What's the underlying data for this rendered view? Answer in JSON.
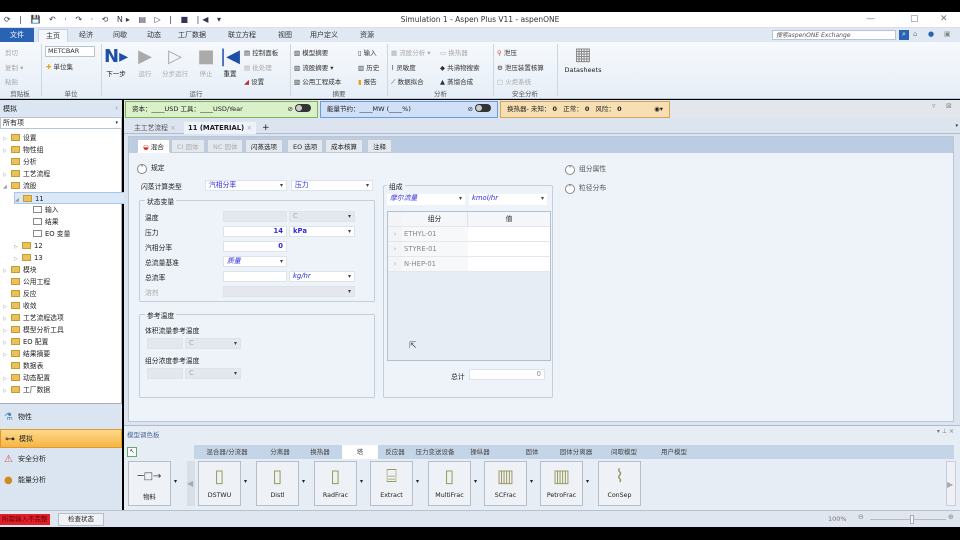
{
  "window": {
    "title": "Simulation 1 - Aspen Plus V11 - aspenONE",
    "quick_access": "⟳ | 💾 ↶ · ↷ · ⟲ N▸ ▤ ▷ | ■ |◀ ▾"
  },
  "menu": {
    "tabs": [
      "文件",
      "主页",
      "经济",
      "间歇",
      "动态",
      "工厂数据",
      "联立方程",
      "视图",
      "用户定义",
      "资源"
    ],
    "search_placeholder": "搜索aspenONE Exchange"
  },
  "ribbon": {
    "clipboard": {
      "cut": "剪切",
      "copy": "复制 ▾",
      "paste": "粘贴",
      "label": "剪贴板"
    },
    "units": {
      "set": "METCBAR",
      "unit_set": "单位集",
      "label": "单位"
    },
    "run": {
      "next": "下一步",
      "run": "运行",
      "step": "分步运行",
      "stop": "停止",
      "reset": "重置",
      "control_panel": "控制面板",
      "batch": "批处理",
      "settings": "设置",
      "label": "运行"
    },
    "summary": {
      "model_summary": "模型摘要",
      "stream_summary": "流股摘要 ▾",
      "utility_cost": "公用工程成本",
      "input": "输入",
      "history": "历史",
      "report": "报告",
      "label": "摘要"
    },
    "analysis": {
      "stream_analysis": "流股分析 ▾",
      "heat_exchanger": "换热器",
      "sensitivity": "灵敏度",
      "data_fit": "数据拟合",
      "azeotrope": "共沸物搜索",
      "distill_synth": "蒸馏合成",
      "label": "分析"
    },
    "safety": {
      "pressure_relief": "泄压",
      "relief_sizing": "泄压装置核算",
      "flare": "火炬系统",
      "label": "安全分析"
    },
    "datasheets": "Datasheets"
  },
  "left": {
    "header": "模拟",
    "filter": "所有项",
    "tree": [
      "设置",
      "物性组",
      "分析",
      "工艺流程",
      "流股",
      "11",
      "输入",
      "结果",
      "EO 变量",
      "12",
      "13",
      "模块",
      "公用工程",
      "反应",
      "收敛",
      "工艺流程选项",
      "模型分析工具",
      "EO 配置",
      "结果摘要",
      "数据表",
      "动态配置",
      "工厂数据"
    ],
    "nav": [
      "物性",
      "模拟",
      "安全分析",
      "能量分析"
    ]
  },
  "status_bars": {
    "capital": "资本：____USD  工具：____USD/Year",
    "energy": "能量节约：____MW  (____%)",
    "hx": {
      "label": "换热器- 未知：",
      "unknown": "0",
      "ok_label": "正常：",
      "ok": "0",
      "risk_label": "风险：",
      "risk": "0"
    },
    "colors": {
      "capital": "#d9f0c8",
      "energy": "#cfe0f7",
      "hx": "#f8dfb3"
    }
  },
  "doc_tabs": [
    "主工艺流程",
    "11 (MATERIAL)",
    "+"
  ],
  "form": {
    "tabs": [
      "混合",
      "CI 固体",
      "NC 固体",
      "闪蒸选项",
      "EO 选项",
      "成本核算",
      "注释"
    ],
    "spec_header": "规定",
    "flash_type_label": "闪蒸计算类型",
    "flash_type_1": "汽相分率",
    "flash_type_2": "压力",
    "state_vars": "状态变量",
    "temp_label": "温度",
    "temp_unit": "C",
    "pressure_label": "压力",
    "pressure_value": "14",
    "pressure_unit": "kPa",
    "vfrac_label": "汽相分率",
    "vfrac_value": "0",
    "flow_basis_label": "总流量基准",
    "flow_basis": "质量",
    "flow_rate_label": "总流率",
    "flow_rate_unit": "kg/hr",
    "solvent_label": "溶剂",
    "ref_temp": "参考温度",
    "vol_ref_label": "体积流量参考温度",
    "vol_ref_unit": "C",
    "conc_ref_label": "组分浓度参考温度",
    "conc_ref_unit": "C",
    "composition": "组成",
    "comp_basis": "摩尔流量",
    "comp_unit": "kmol/hr",
    "grid_headers": [
      "组分",
      "值"
    ],
    "components": [
      "ETHYL-01",
      "STYRE-01",
      "N-HEP-01"
    ],
    "total_label": "总计",
    "total_value": "0",
    "comp_props": "组分属性",
    "psd": "粒径分布"
  },
  "palette": {
    "title": "模型调色板",
    "tabs": [
      "混合器/分流器",
      "分离器",
      "换热器",
      "塔",
      "反应器",
      "压力变送设备",
      "操纵器",
      "固体",
      "固体分离器",
      "间歇模型",
      "用户模型"
    ],
    "items": [
      "物料",
      "DSTWU",
      "Distl",
      "RadFrac",
      "Extract",
      "MultiFrac",
      "SCFrac",
      "PetroFrac",
      "ConSep"
    ]
  },
  "statusbar": {
    "error": "所需输入不完整",
    "check": "检查状态",
    "zoom": "100%",
    "zoom_level": 0.55
  }
}
